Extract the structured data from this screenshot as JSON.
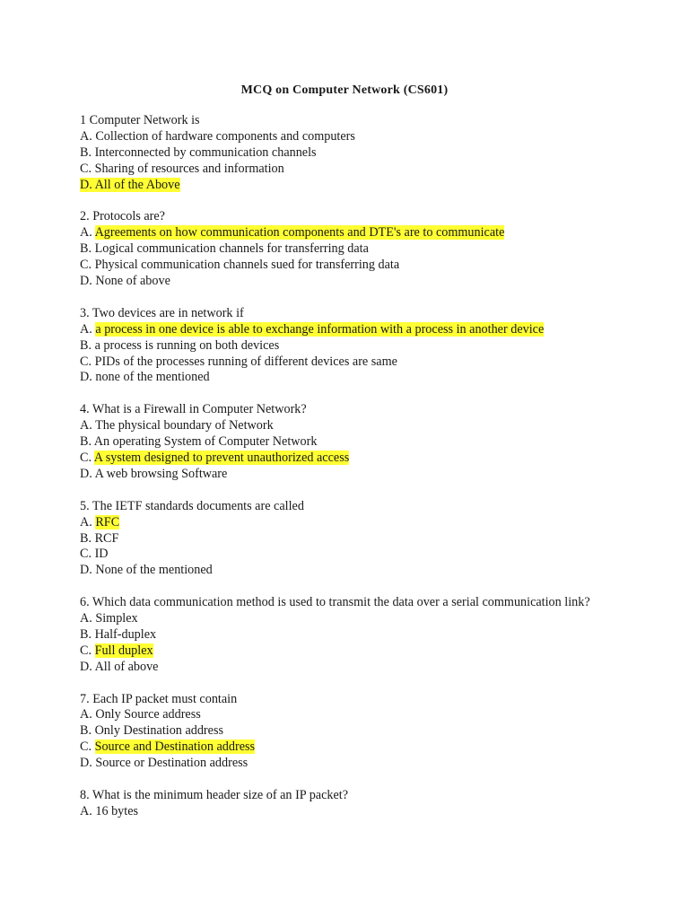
{
  "document": {
    "title": "MCQ on Computer Network (CS601)",
    "highlight_color": "#ffff33",
    "questions": [
      {
        "text": "1 Computer Network is",
        "options": [
          {
            "letter": "A.",
            "text": "Collection of hardware components and computers",
            "highlighted": false
          },
          {
            "letter": "B.",
            "text": "Interconnected by communication channels",
            "highlighted": false
          },
          {
            "letter": "C.",
            "text": "Sharing of resources and information",
            "highlighted": false
          },
          {
            "letter": "D.",
            "text": "All of the Above",
            "highlighted": true,
            "highlight_includes_letter": true
          }
        ]
      },
      {
        "text": "2. Protocols are?",
        "options": [
          {
            "letter": "A.",
            "text": "Agreements on how communication components and DTE's are to communicate",
            "highlighted": true
          },
          {
            "letter": "B.",
            "text": "Logical communication channels for transferring data",
            "highlighted": false
          },
          {
            "letter": "C.",
            "text": "Physical communication channels sued for transferring data",
            "highlighted": false
          },
          {
            "letter": "D.",
            "text": "None of above",
            "highlighted": false
          }
        ]
      },
      {
        "text": "3. Two devices are in network if",
        "options": [
          {
            "letter": "A.",
            "text": "a process in one device is able to exchange information with a process in another device",
            "highlighted": true
          },
          {
            "letter": "B.",
            "text": "a process is running on both devices",
            "highlighted": false
          },
          {
            "letter": "C.",
            "text": "PIDs of the processes running of different devices are same",
            "highlighted": false
          },
          {
            "letter": "D.",
            "text": "none of the mentioned",
            "highlighted": false
          }
        ]
      },
      {
        "text": "4. What is a Firewall in Computer Network?",
        "options": [
          {
            "letter": "A.",
            "text": "The physical boundary of Network",
            "highlighted": false
          },
          {
            "letter": "B.",
            "text": "An operating System of Computer Network",
            "highlighted": false
          },
          {
            "letter": "C.",
            "text": "A system designed to prevent unauthorized access",
            "highlighted": true
          },
          {
            "letter": "D.",
            "text": "A web browsing Software",
            "highlighted": false
          }
        ]
      },
      {
        "text": "5. The IETF standards documents are called",
        "options": [
          {
            "letter": "A.",
            "text": "RFC",
            "highlighted": true
          },
          {
            "letter": "B.",
            "text": "RCF",
            "highlighted": false
          },
          {
            "letter": "C.",
            "text": "ID",
            "highlighted": false
          },
          {
            "letter": "D.",
            "text": "None of the mentioned",
            "highlighted": false
          }
        ]
      },
      {
        "text": "6. Which data communication method is used to transmit the data over a serial communication link?",
        "options": [
          {
            "letter": "A.",
            "text": "Simplex",
            "highlighted": false
          },
          {
            "letter": "B.",
            "text": "Half-duplex",
            "highlighted": false
          },
          {
            "letter": "C.",
            "text": "Full duplex",
            "highlighted": true
          },
          {
            "letter": "D.",
            "text": "All of above",
            "highlighted": false
          }
        ]
      },
      {
        "text": "7. Each IP packet must contain",
        "options": [
          {
            "letter": "A.",
            "text": "Only Source address",
            "highlighted": false
          },
          {
            "letter": "B.",
            "text": "Only Destination address",
            "highlighted": false
          },
          {
            "letter": "C.",
            "text": "Source and Destination address",
            "highlighted": true
          },
          {
            "letter": "D.",
            "text": "Source or Destination address",
            "highlighted": false
          }
        ]
      },
      {
        "text": "8. What is the minimum header size of an IP packet?",
        "options": [
          {
            "letter": "A.",
            "text": "16 bytes",
            "highlighted": false
          }
        ]
      }
    ]
  }
}
